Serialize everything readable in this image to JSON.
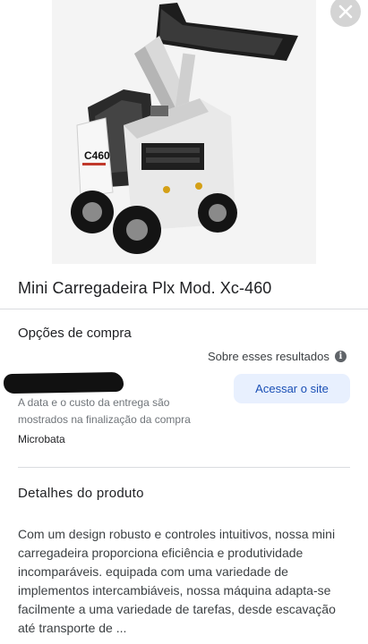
{
  "product": {
    "title": "Mini Carregadeira Plx Mod. Xc-460",
    "image_alt": "Mini carregadeira C460 com caçamba levantada",
    "image_label": "C460"
  },
  "buying_options": {
    "heading": "Opções de compra",
    "about_results": "Sobre esses resultados",
    "info_icon": "info-icon",
    "delivery_note": "A data e o custo da entrega são mostrados na finalização da compra",
    "seller": "Microbata",
    "visit_label": "Acessar o site"
  },
  "details": {
    "heading": "Detalhes do produto",
    "description": "Com um design robusto e controles intuitivos, nossa mini carregadeira proporciona eficiência e produtividade incomparáveis. equipada com uma variedade de implementos intercambiáveis, nossa máquina adapta-se facilmente a uma variedade de tarefas, desde escavação até transporte de ..."
  },
  "close": {
    "icon": "close-icon"
  },
  "colors": {
    "accent": "#1a4fb5",
    "button_bg": "#e8f0fe",
    "divider": "#dadce0"
  }
}
